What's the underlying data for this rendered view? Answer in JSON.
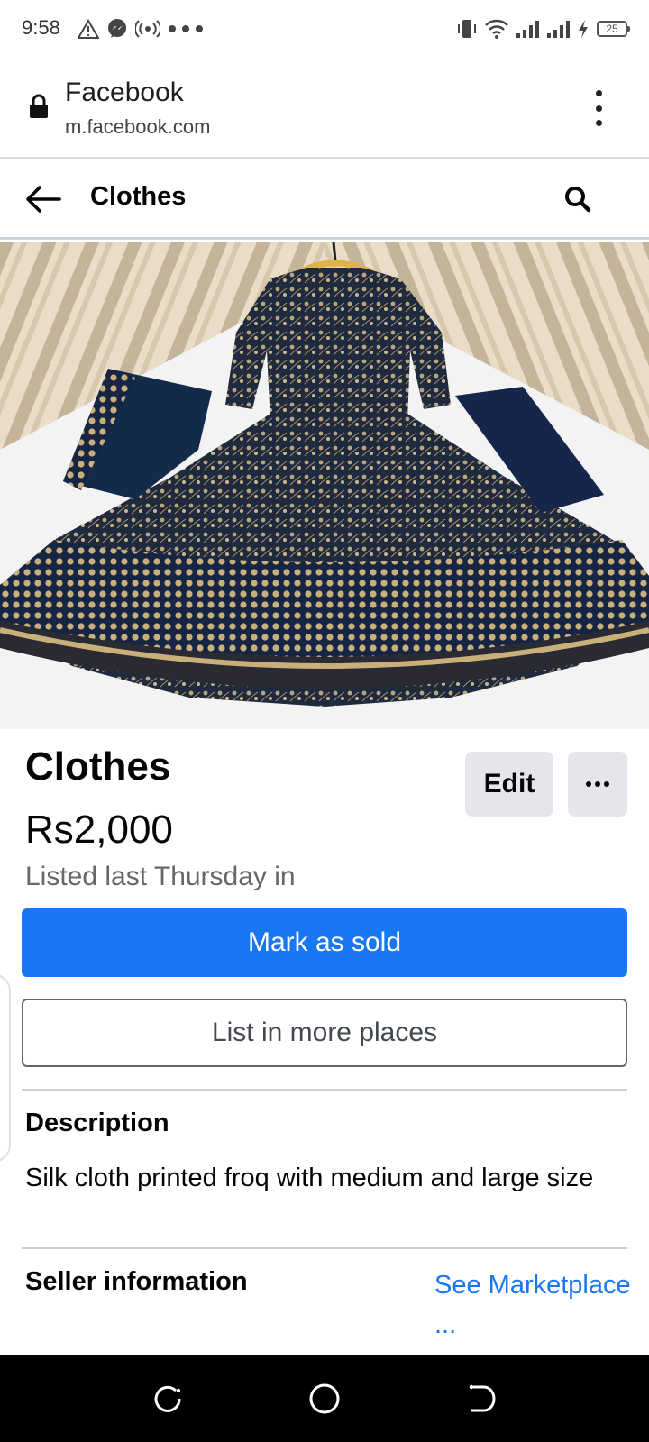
{
  "status_bar": {
    "time": "9:58",
    "battery": "25",
    "icons_left": [
      "warning-icon",
      "messenger-icon",
      "hotspot-icon",
      "more-dots-icon"
    ],
    "icons_right": [
      "vibrate-icon",
      "wifi-icon",
      "signal-icon",
      "signal-icon",
      "charging-icon",
      "battery-icon"
    ]
  },
  "browser": {
    "title": "Facebook",
    "url": "m.facebook.com"
  },
  "header": {
    "title": "Clothes"
  },
  "listing": {
    "title": "Clothes",
    "price": "Rs2,000",
    "listed": "Listed last Thursday in",
    "edit_label": "Edit",
    "mark_sold_label": "Mark as sold",
    "list_more_label": "List in more places",
    "description_heading": "Description",
    "description": "Silk cloth printed froq with medium and large size",
    "seller_heading": "Seller information",
    "see_marketplace": "See Marketplace ..."
  },
  "colors": {
    "accent": "#1877f2",
    "secondary_button": "#e4e6eb",
    "muted_text": "#65676b"
  }
}
